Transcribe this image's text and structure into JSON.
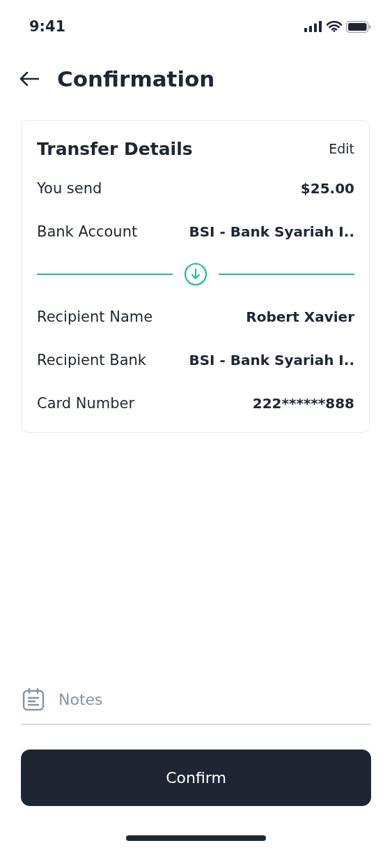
{
  "status_bar": {
    "time": "9:41"
  },
  "header": {
    "title": "Confirmation"
  },
  "card": {
    "title": "Transfer Details",
    "action": "Edit",
    "sender_rows": [
      {
        "label": "You send",
        "value": "$25.00"
      },
      {
        "label": "Bank Account",
        "value": "BSI - Bank Syariah I.."
      }
    ],
    "recipient_rows": [
      {
        "label": "Recipient Name",
        "value": "Robert Xavier"
      },
      {
        "label": "Recipient Bank",
        "value": "BSI - Bank Syariah I.."
      },
      {
        "label": "Card Number",
        "value": "222******888"
      }
    ]
  },
  "notes": {
    "placeholder": "Notes"
  },
  "button": "Confirm"
}
